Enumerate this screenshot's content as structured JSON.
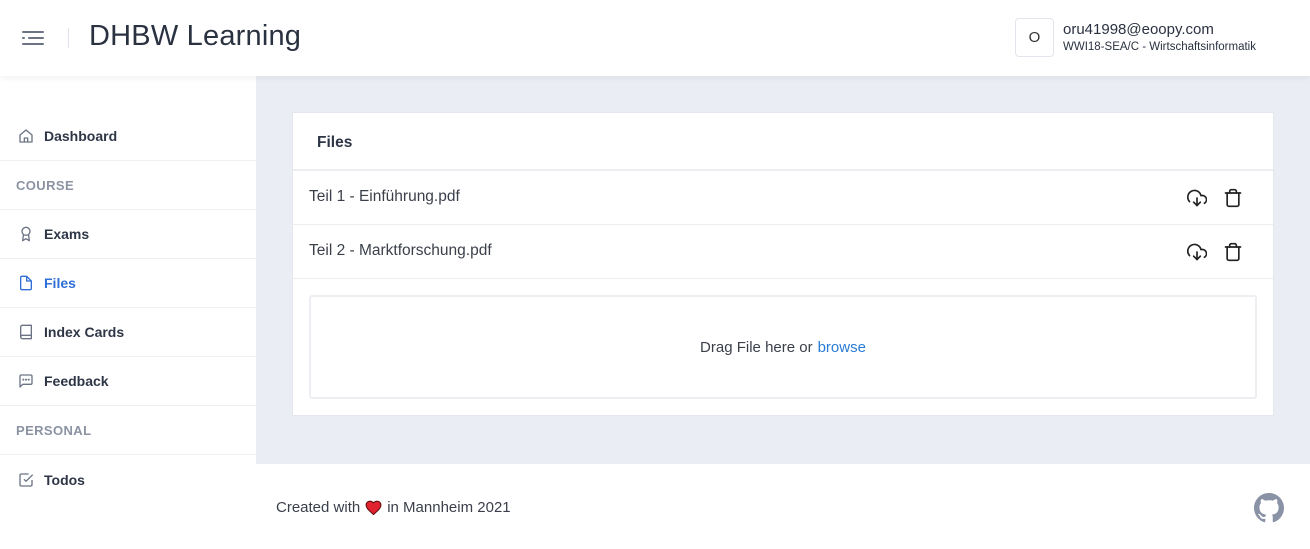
{
  "header": {
    "title": "DHBW Learning",
    "avatar_initial": "O",
    "user_email": "oru41998@eoopy.com",
    "user_course": "WWI18-SEA/C - Wirtschaftsinformatik"
  },
  "sidebar": {
    "dashboard": "Dashboard",
    "section_course": "COURSE",
    "exams": "Exams",
    "files": "Files",
    "index_cards": "Index Cards",
    "feedback": "Feedback",
    "section_personal": "PERSONAL",
    "todos": "Todos",
    "active_item": "Files",
    "active_color": "#2f6fd6"
  },
  "files_card": {
    "title": "Files",
    "files": [
      {
        "name": "Teil 1 - Einführung.pdf"
      },
      {
        "name": "Teil 2 - Marktforschung.pdf"
      }
    ],
    "dropzone_text": "Drag File here or",
    "dropzone_link": "browse",
    "link_color": "#2a7bd4"
  },
  "footer": {
    "text_before": "Created with",
    "text_after": "in Mannheim 2021",
    "heart_color": "#e0232e"
  },
  "icons": {
    "menu": "hamburger-menu-icon",
    "dashboard": "home-icon",
    "exams": "award-icon",
    "files": "file-icon",
    "index_cards": "book-icon",
    "feedback": "message-square-icon",
    "todos": "check-square-icon",
    "download": "cloud-download-icon",
    "delete": "trash-icon",
    "github": "github-icon"
  }
}
